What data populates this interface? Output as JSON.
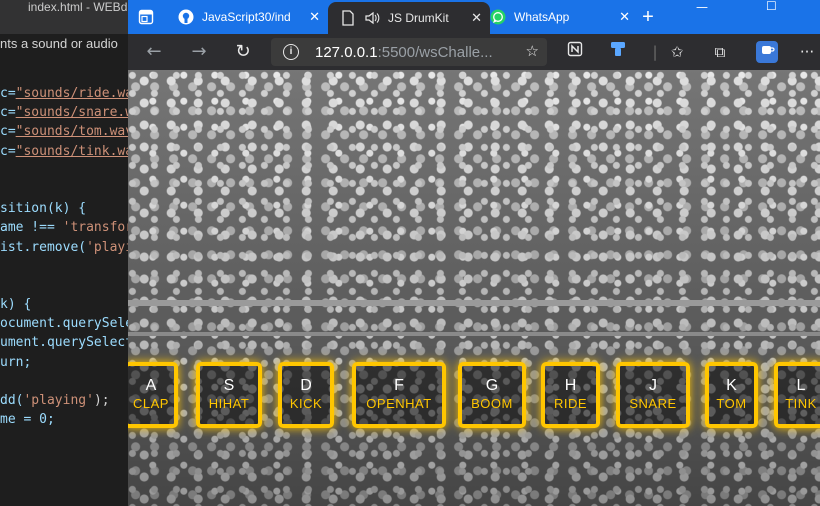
{
  "editor": {
    "title": "index.html - WEBd",
    "subtitle": "nts a sound or audio",
    "lines": [
      {
        "pre": "c=",
        "str": "\"sounds/ride.wa",
        "post": ""
      },
      {
        "pre": "c=",
        "str": "\"sounds/snare.w",
        "post": ""
      },
      {
        "pre": "c=",
        "str": "\"sounds/tom.wav",
        "post": ""
      },
      {
        "pre": "c=",
        "str": "\"sounds/tink.wa",
        "post": ""
      },
      {
        "pre": "",
        "str": "",
        "post": ""
      },
      {
        "pre": "",
        "str": "",
        "post": ""
      },
      {
        "pre": "sition(k) {",
        "str": "",
        "post": ""
      },
      {
        "pre": "ame !== ",
        "str": "'transfor",
        "post": ""
      },
      {
        "pre": "ist.remove(",
        "str": "'playi",
        "post": ""
      },
      {
        "pre": "",
        "str": "",
        "post": ""
      },
      {
        "pre": "",
        "str": "",
        "post": ""
      },
      {
        "pre": "k) {",
        "str": "",
        "post": ""
      },
      {
        "pre": "ocument.querySele",
        "str": "",
        "post": ""
      },
      {
        "pre": "ument.querySelect",
        "str": "",
        "post": ""
      },
      {
        "pre": "urn;",
        "str": "",
        "post": ""
      },
      {
        "pre": "",
        "str": "",
        "post": ""
      },
      {
        "pre": "dd(",
        "str": "'playing'",
        "post": ");"
      },
      {
        "pre": "me = 0;",
        "str": "",
        "post": ""
      }
    ]
  },
  "browser": {
    "tabs": [
      {
        "label": "JavaScript30/ind",
        "icon": "github-icon"
      },
      {
        "label": "JS DrumKit",
        "icon": "page-icon"
      },
      {
        "label": "WhatsApp",
        "icon": "whatsapp-icon"
      }
    ],
    "new_tab": "+",
    "address": {
      "host": "127.0.0.1",
      "rest": ":5500/wsChalle..."
    }
  },
  "drumkit": {
    "accent": "#ffc600",
    "keys": [
      {
        "key": "A",
        "sound": "CLAP"
      },
      {
        "key": "S",
        "sound": "HIHAT"
      },
      {
        "key": "D",
        "sound": "KICK"
      },
      {
        "key": "F",
        "sound": "OPENHAT"
      },
      {
        "key": "G",
        "sound": "BOOM"
      },
      {
        "key": "H",
        "sound": "RIDE"
      },
      {
        "key": "J",
        "sound": "SNARE"
      },
      {
        "key": "K",
        "sound": "TOM"
      },
      {
        "key": "L",
        "sound": "TINK"
      }
    ]
  }
}
